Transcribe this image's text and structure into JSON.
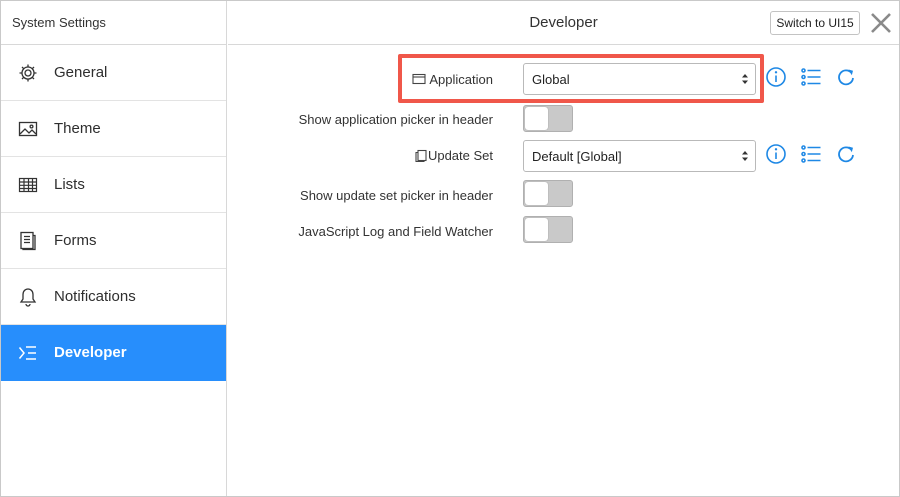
{
  "sidebar": {
    "title": "System Settings",
    "items": [
      {
        "label": "General",
        "icon": "gear-icon"
      },
      {
        "label": "Theme",
        "icon": "image-icon"
      },
      {
        "label": "Lists",
        "icon": "table-icon"
      },
      {
        "label": "Forms",
        "icon": "form-icon"
      },
      {
        "label": "Notifications",
        "icon": "bell-icon"
      },
      {
        "label": "Developer",
        "icon": "developer-icon",
        "active": true
      }
    ]
  },
  "header": {
    "title": "Developer",
    "switch_label": "Switch to UI15"
  },
  "form": {
    "application": {
      "label": "Application",
      "value": "Global"
    },
    "show_app_picker": {
      "label": "Show application picker in header",
      "enabled": false
    },
    "update_set": {
      "label": "Update Set",
      "value": "Default [Global]"
    },
    "show_update_set_picker": {
      "label": "Show update set picker in header",
      "enabled": false
    },
    "js_log": {
      "label": "JavaScript Log and Field Watcher",
      "enabled": false
    }
  },
  "colors": {
    "accent": "#278efc",
    "highlight": "#f0574a",
    "icon_blue": "#1e88e5"
  }
}
